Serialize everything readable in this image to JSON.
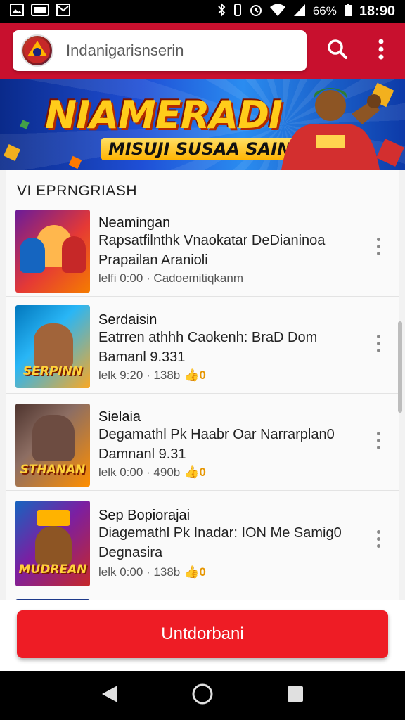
{
  "status_bar": {
    "time": "18:90",
    "battery": "66%",
    "icons": [
      "image-icon",
      "sim-icon",
      "mail-icon",
      "bluetooth-icon",
      "vibrate-icon",
      "alarm-icon",
      "wifi-icon",
      "signal-icon"
    ]
  },
  "app_bar": {
    "search_placeholder": "Indanigarisnserin",
    "logo_icon": "app-logo-icon",
    "search_icon": "search-icon",
    "more_icon": "more-vert-icon",
    "color": "#c8102e"
  },
  "banner": {
    "title": "NIAMERADI",
    "subtitle": "MISUJI SUSAA SAIN"
  },
  "section": {
    "title": "VI EPRNGRIASH"
  },
  "items": [
    {
      "title": "Neamingan",
      "desc_line1": "Rapsatfilnthk Vnaokatar DeDianinoa",
      "desc_line2": "Prapailan Aranioli",
      "meta": "lelfi 0:00 · Cadoemitiqkanm",
      "badge": "",
      "thumb_label": "",
      "thumb_colors": [
        "#6a1b9a",
        "#f57c00"
      ]
    },
    {
      "title": "Serdaisin",
      "desc_line1": "Eatrren athhh Caokenh: BraD Dom",
      "desc_line2": "Bamanl 9.331",
      "meta": "lelk 9:20 · 138b",
      "badge": "👍0",
      "thumb_label": "SERPINN",
      "thumb_colors": [
        "#0277bd",
        "#f9a825"
      ]
    },
    {
      "title": "Sielaia",
      "desc_line1": "Degamathl Pk Haabr Oar Narrarplan0",
      "desc_line2": "Damnanl 9.31",
      "meta": "lelk 0:00 · 490b",
      "badge": "👍0",
      "thumb_label": "STHANAN",
      "thumb_colors": [
        "#4e342e",
        "#ff8f00"
      ]
    },
    {
      "title": "Sep Bopiorajai",
      "desc_line1": "Diagemathl Pk Inadar: ION Me Samig0",
      "desc_line2": "Degnasira",
      "meta": "lelk 0:00 · 138b",
      "badge": "👍0",
      "thumb_label": "MUDREAN",
      "thumb_colors": [
        "#1565c0",
        "#c62828"
      ]
    }
  ],
  "cta": {
    "label": "Untdorbani",
    "color": "#ee1c25"
  },
  "nav_bar": {
    "icons": [
      "back-icon",
      "home-icon",
      "recents-icon"
    ]
  }
}
